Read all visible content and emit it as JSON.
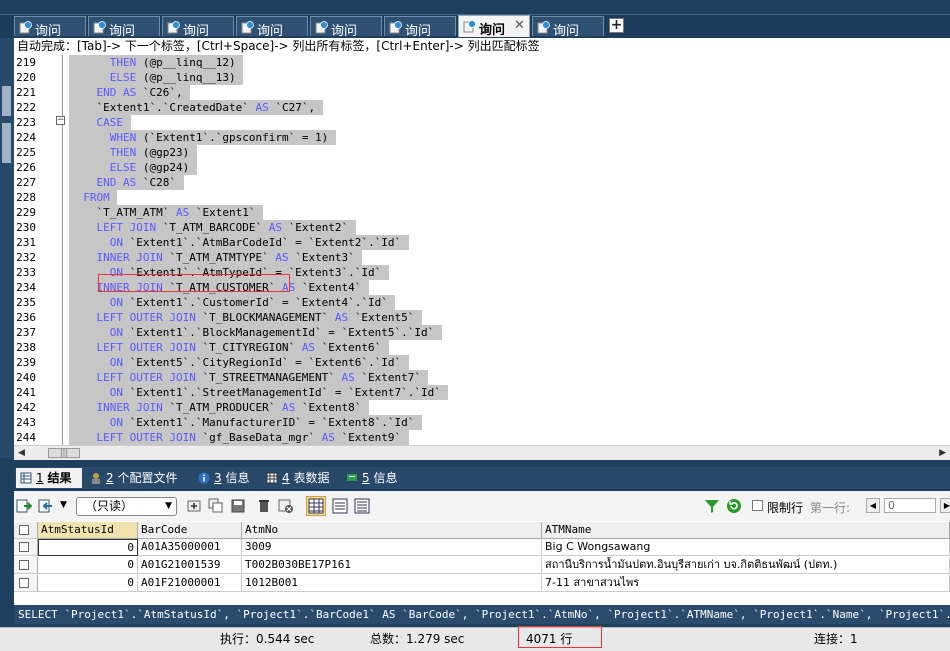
{
  "tabs": [
    {
      "label": "询问"
    },
    {
      "label": "询问"
    },
    {
      "label": "询问"
    },
    {
      "label": "询问"
    },
    {
      "label": "询问"
    },
    {
      "label": "询问"
    },
    {
      "label": "询问",
      "active": true,
      "close": "✕"
    },
    {
      "label": "询问"
    }
  ],
  "new_tab_label": "+",
  "hint": "自动完成：[Tab]-> 下一个标签，[Ctrl+Space]-> 列出所有标签，[Ctrl+Enter]-> 列出匹配标签",
  "editor": {
    "fold_symbol": "−",
    "lines": [
      {
        "n": "219",
        "pre": "      ",
        "parts": [
          [
            "kw",
            "THEN"
          ],
          [
            "t",
            " (@p__linq__12)"
          ]
        ]
      },
      {
        "n": "220",
        "pre": "      ",
        "parts": [
          [
            "kw",
            "ELSE"
          ],
          [
            "t",
            " (@p__linq__13)"
          ]
        ]
      },
      {
        "n": "221",
        "pre": "    ",
        "parts": [
          [
            "kw",
            "END"
          ],
          [
            "t",
            " "
          ],
          [
            "kw",
            "AS"
          ],
          [
            "t",
            " `C26`,"
          ]
        ]
      },
      {
        "n": "222",
        "pre": "    ",
        "parts": [
          [
            "t",
            "`Extent1`.`CreatedDate` "
          ],
          [
            "kw",
            "AS"
          ],
          [
            "t",
            " `C27`,"
          ]
        ]
      },
      {
        "n": "223",
        "pre": "    ",
        "parts": [
          [
            "kw",
            "CASE"
          ]
        ]
      },
      {
        "n": "224",
        "pre": "      ",
        "parts": [
          [
            "kw",
            "WHEN"
          ],
          [
            "t",
            " (`Extent1`.`gpsconfirm` = 1)"
          ]
        ]
      },
      {
        "n": "225",
        "pre": "      ",
        "parts": [
          [
            "kw",
            "THEN"
          ],
          [
            "t",
            " (@gp23)"
          ]
        ]
      },
      {
        "n": "226",
        "pre": "      ",
        "parts": [
          [
            "kw",
            "ELSE"
          ],
          [
            "t",
            " (@gp24)"
          ]
        ]
      },
      {
        "n": "227",
        "pre": "    ",
        "parts": [
          [
            "kw",
            "END"
          ],
          [
            "t",
            " "
          ],
          [
            "kw",
            "AS"
          ],
          [
            "t",
            " `C28`"
          ]
        ]
      },
      {
        "n": "228",
        "pre": "  ",
        "parts": [
          [
            "kw",
            "FROM"
          ]
        ]
      },
      {
        "n": "229",
        "pre": "    ",
        "parts": [
          [
            "t",
            "`T_ATM_ATM` "
          ],
          [
            "kw",
            "AS"
          ],
          [
            "t",
            " `Extent1`"
          ]
        ]
      },
      {
        "n": "230",
        "pre": "    ",
        "parts": [
          [
            "kw",
            "LEFT JOIN"
          ],
          [
            "t",
            " `T_ATM_BARCODE` "
          ],
          [
            "kw",
            "AS"
          ],
          [
            "t",
            " `Extent2`"
          ]
        ]
      },
      {
        "n": "231",
        "pre": "      ",
        "parts": [
          [
            "kw",
            "ON"
          ],
          [
            "t",
            " `Extent1`.`AtmBarCodeId` = `Extent2`.`Id`"
          ]
        ]
      },
      {
        "n": "232",
        "pre": "    ",
        "parts": [
          [
            "kw",
            "INNER JOIN"
          ],
          [
            "t",
            " `T_ATM_ATMTYPE` "
          ],
          [
            "kw",
            "AS"
          ],
          [
            "t",
            " `Extent3`"
          ]
        ]
      },
      {
        "n": "233",
        "pre": "      ",
        "parts": [
          [
            "kw",
            "ON"
          ],
          [
            "t",
            " `Extent1`.`AtmTypeId` = `Extent3`.`Id`"
          ]
        ]
      },
      {
        "n": "234",
        "pre": "    ",
        "parts": [
          [
            "kw",
            "INNER JOIN"
          ],
          [
            "t",
            " `T_ATM_CUSTOMER` "
          ],
          [
            "kw",
            "AS"
          ],
          [
            "t",
            " `Extent4`"
          ]
        ]
      },
      {
        "n": "235",
        "pre": "      ",
        "parts": [
          [
            "kw",
            "ON"
          ],
          [
            "t",
            " `Extent1`.`CustomerId` = `Extent4`.`Id`"
          ]
        ]
      },
      {
        "n": "236",
        "pre": "    ",
        "parts": [
          [
            "kw",
            "LEFT OUTER JOIN"
          ],
          [
            "t",
            " `T_BLOCKMANAGEMENT` "
          ],
          [
            "kw",
            "AS"
          ],
          [
            "t",
            " `Extent5`"
          ]
        ]
      },
      {
        "n": "237",
        "pre": "      ",
        "parts": [
          [
            "kw",
            "ON"
          ],
          [
            "t",
            " `Extent1`.`BlockManagementId` = `Extent5`.`Id`"
          ]
        ]
      },
      {
        "n": "238",
        "pre": "    ",
        "parts": [
          [
            "kw",
            "LEFT OUTER JOIN"
          ],
          [
            "t",
            " `T_CITYREGION` "
          ],
          [
            "kw",
            "AS"
          ],
          [
            "t",
            " `Extent6`"
          ]
        ]
      },
      {
        "n": "239",
        "pre": "      ",
        "parts": [
          [
            "kw",
            "ON"
          ],
          [
            "t",
            " `Extent5`.`CityRegionId` = `Extent6`.`Id`"
          ]
        ]
      },
      {
        "n": "240",
        "pre": "    ",
        "parts": [
          [
            "kw",
            "LEFT OUTER JOIN"
          ],
          [
            "t",
            " `T_STREETMANAGEMENT` "
          ],
          [
            "kw",
            "AS"
          ],
          [
            "t",
            " `Extent7`"
          ]
        ]
      },
      {
        "n": "241",
        "pre": "      ",
        "parts": [
          [
            "kw",
            "ON"
          ],
          [
            "t",
            " `Extent1`.`StreetManagementId` = `Extent7`.`Id`"
          ]
        ]
      },
      {
        "n": "242",
        "pre": "    ",
        "parts": [
          [
            "kw",
            "INNER JOIN"
          ],
          [
            "t",
            " `T_ATM_PRODUCER` "
          ],
          [
            "kw",
            "AS"
          ],
          [
            "t",
            " `Extent8`"
          ]
        ]
      },
      {
        "n": "243",
        "pre": "      ",
        "parts": [
          [
            "kw",
            "ON"
          ],
          [
            "t",
            " `Extent1`.`ManufacturerID` = `Extent8`.`Id`"
          ]
        ]
      },
      {
        "n": "244",
        "pre": "    ",
        "parts": [
          [
            "kw",
            "LEFT OUTER JOIN"
          ],
          [
            "t",
            " `gf_BaseData_mgr` "
          ],
          [
            "kw",
            "AS"
          ],
          [
            "t",
            " `Extent9`"
          ]
        ]
      }
    ]
  },
  "scroll_thumb": "|||",
  "result_tabs": [
    {
      "num": "1",
      "label": "结果",
      "active": true,
      "icon": "grid-icon"
    },
    {
      "num": "2",
      "label": "个配置文件",
      "icon": "profile-icon"
    },
    {
      "num": "3",
      "label": "信息",
      "icon": "info-icon"
    },
    {
      "num": "4",
      "label": "表数据",
      "icon": "table-icon"
    },
    {
      "num": "5",
      "label": "信息",
      "icon": "message-icon"
    }
  ],
  "toolbar": {
    "mode_select": "（只读）",
    "limit_label": "限制行",
    "first_row_label": "第一行:",
    "first_row_value": "0"
  },
  "grid": {
    "columns": [
      "AtmStatusId",
      "BarCode",
      "AtmNo",
      "ATMName"
    ],
    "rows": [
      [
        "0",
        "A01A35000001",
        "3009",
        "Big C Wongsawang"
      ],
      [
        "0",
        "A01G21001539",
        "T002B030BE17P161",
        "สถานีบริการน้ำมันปตท.อินบุรีสายเก่า บจ.กิตติธนพัฒน์ (ปตท.)"
      ],
      [
        "0",
        "A01F21000001",
        "1012B001",
        "7-11 สาขาสวนไพร"
      ]
    ]
  },
  "sql_preview": "SELECT `Project1`.`AtmStatusId`, `Project1`.`BarCode1` AS `BarCode`, `Project1`.`AtmNo`, `Project1`.`ATMName`, `Project1`.`Name`, `Project1`.…",
  "status": {
    "exec": "执行：0.544 sec",
    "total": "总数：1.279 sec",
    "rows": "4071 行",
    "conn": "连接：1"
  },
  "colors": {
    "keyword": "#5a5aff",
    "selection": "#c6c6c6",
    "frame": "#1f3f5e",
    "highlight_box": "#e33333"
  }
}
